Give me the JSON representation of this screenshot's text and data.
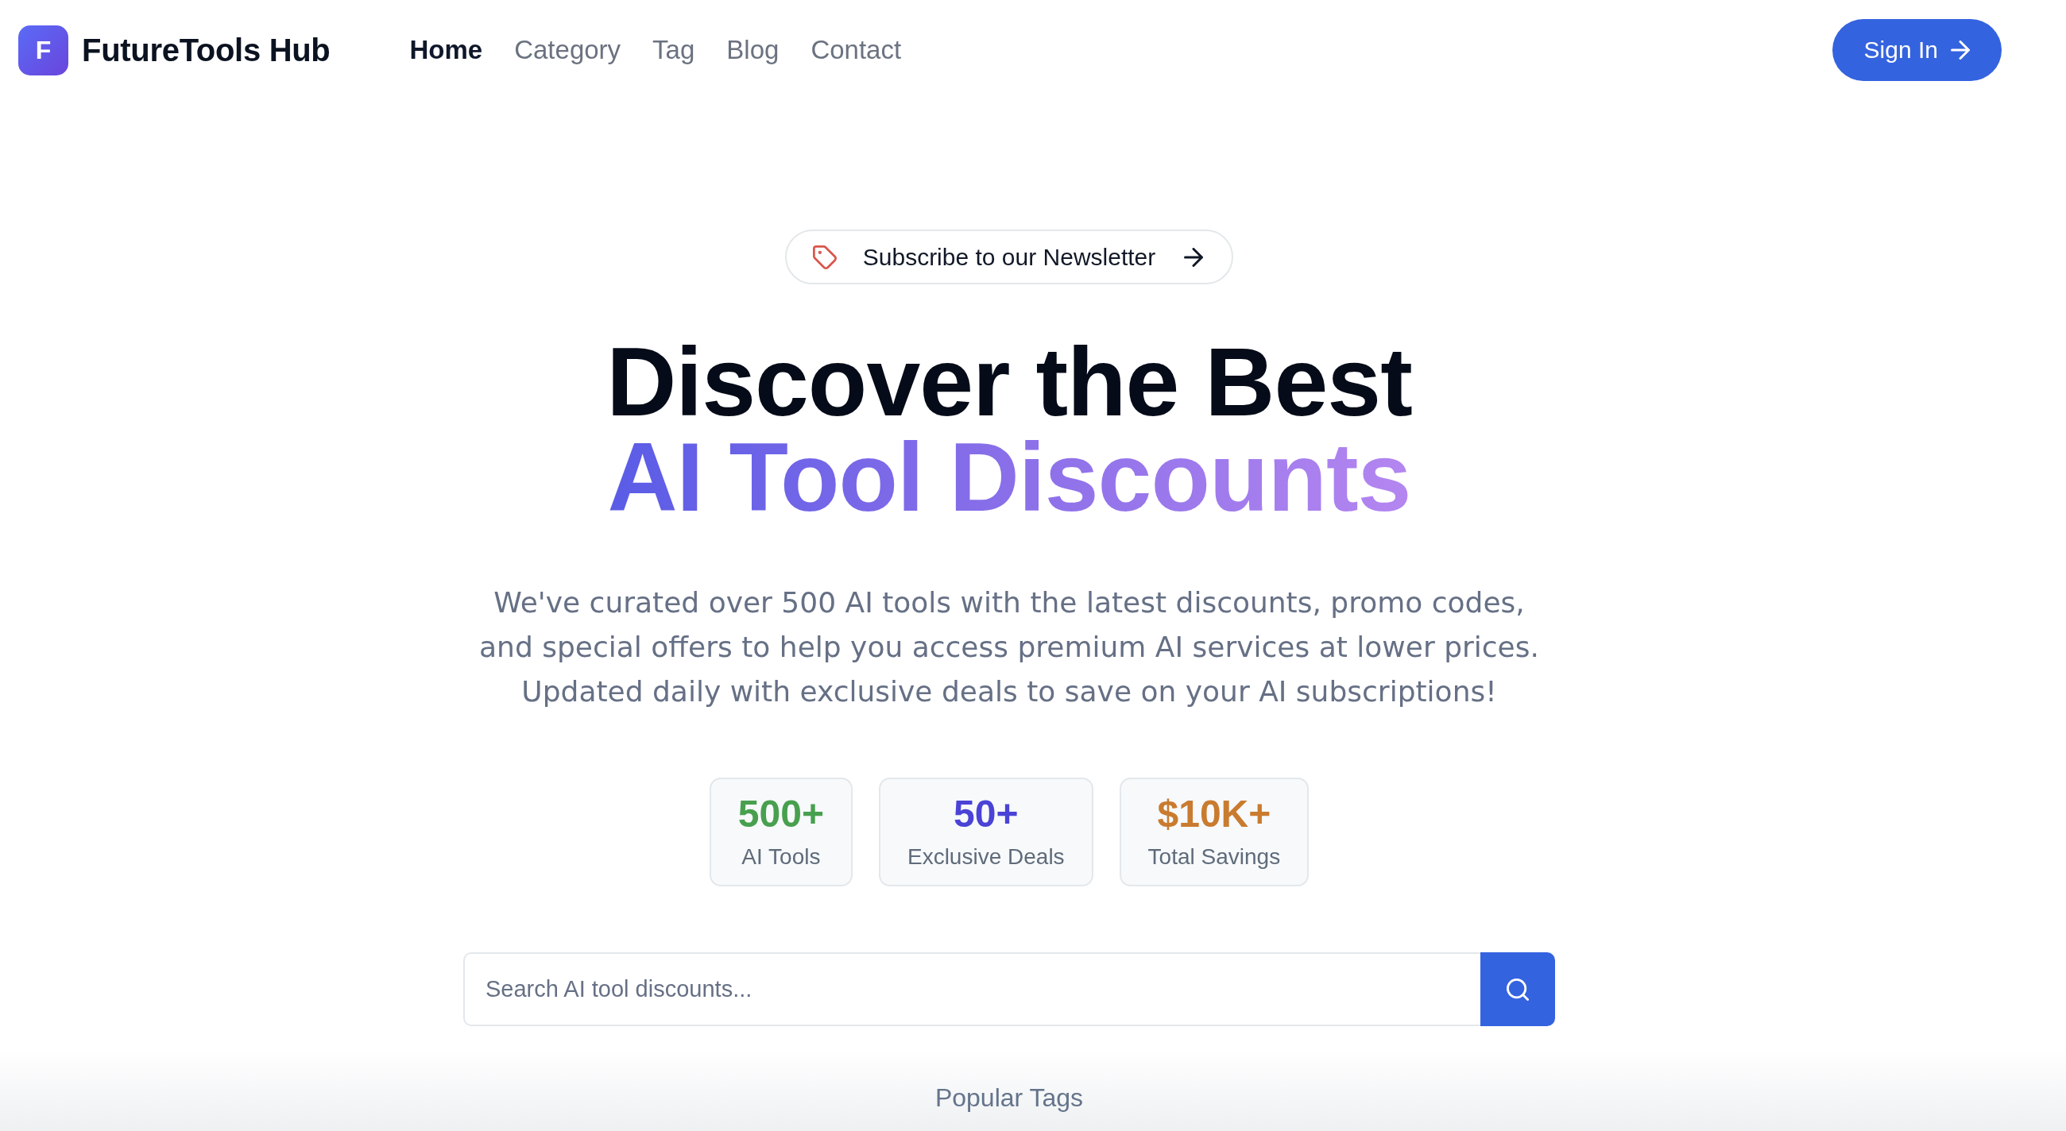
{
  "header": {
    "logo_letter": "F",
    "brand": "FutureTools Hub",
    "nav": [
      {
        "label": "Home",
        "selected": true
      },
      {
        "label": "Category",
        "selected": false
      },
      {
        "label": "Tag",
        "selected": false
      },
      {
        "label": "Blog",
        "selected": false
      },
      {
        "label": "Contact",
        "selected": false
      }
    ],
    "sign_in": "Sign In"
  },
  "hero": {
    "newsletter": "Subscribe to our Newsletter",
    "headline": "Discover the Best",
    "headline_highlight": "AI Tool Discounts",
    "description": "We've curated over 500 AI tools with the latest discounts, promo codes,\nand special offers to help you access premium AI services at lower prices.\nUpdated daily with exclusive deals to save on your AI subscriptions!",
    "stats": [
      {
        "value": "500+",
        "label": "AI Tools",
        "color": "#48a04f"
      },
      {
        "value": "50+",
        "label": "Exclusive Deals",
        "color": "#4a43d6"
      },
      {
        "value": "$10K+",
        "label": "Total Savings",
        "color": "#c97b2f"
      }
    ],
    "search": {
      "placeholder": "Search AI tool discounts..."
    }
  },
  "popular_tags": {
    "title": "Popular Tags"
  }
}
